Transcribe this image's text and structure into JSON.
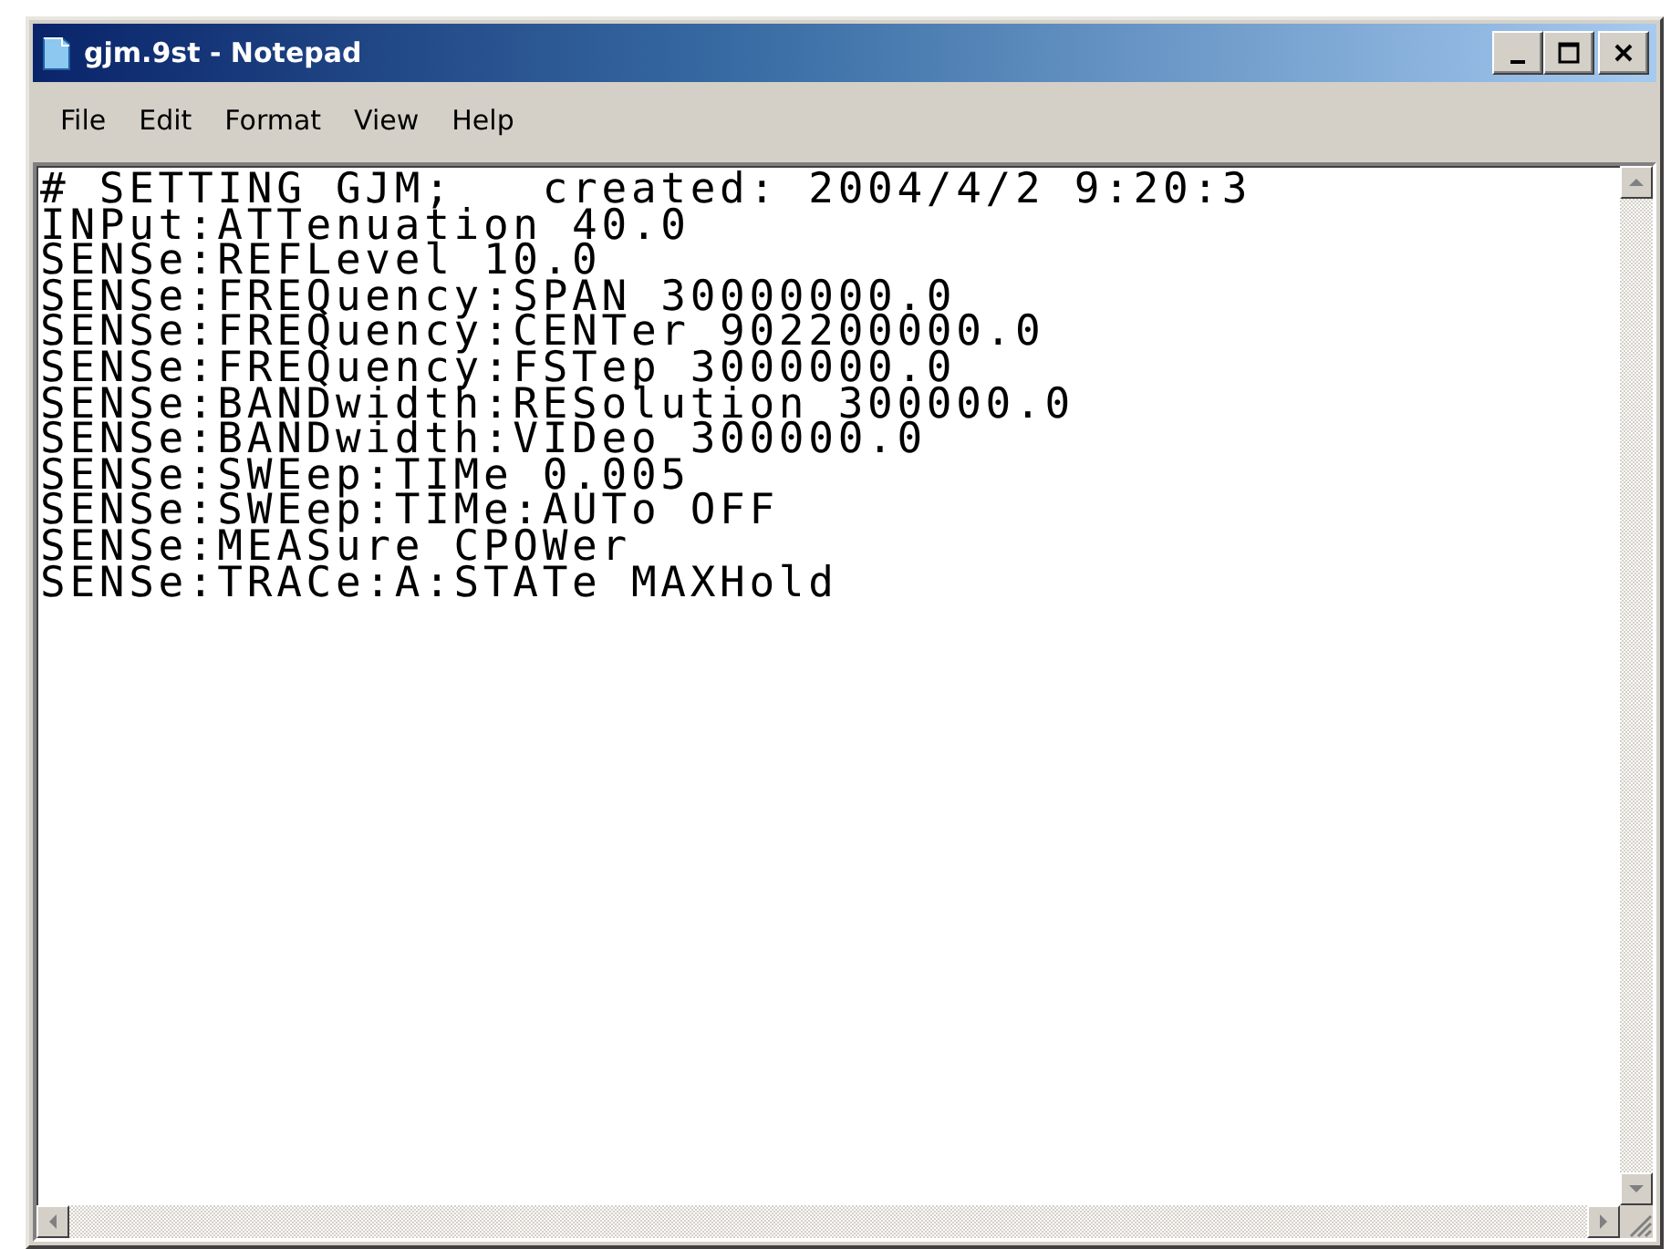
{
  "window": {
    "title": "gjm.9st - Notepad"
  },
  "menu": [
    "File",
    "Edit",
    "Format",
    "View",
    "Help"
  ],
  "document": {
    "lines": [
      "# SETTING GJM;   created: 2004/4/2 9:20:3",
      "INPut:ATTenuation 40.0",
      "SENSe:REFLevel 10.0",
      "SENSe:FREQuency:SPAN 30000000.0",
      "SENSe:FREQuency:CENTer 902200000.0",
      "SENSe:FREQuency:FSTep 3000000.0",
      "SENSe:BANDwidth:RESolution 300000.0",
      "SENSe:BANDwidth:VIDeo 300000.0",
      "SENSe:SWEep:TIMe 0.005",
      "SENSe:SWEep:TIMe:AUTo OFF",
      "SENSe:MEASure CPOWer",
      "SENSe:TRACe:A:STATe MAXHold"
    ]
  }
}
